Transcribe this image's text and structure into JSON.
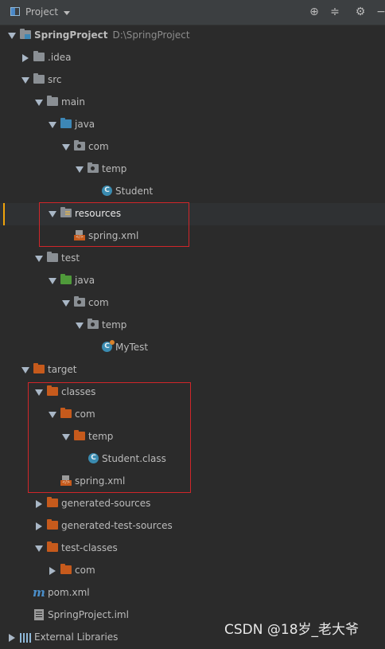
{
  "header": {
    "title": "Project"
  },
  "tree": {
    "project_name": "SpringProject",
    "project_path": "D:\\SpringProject",
    "idea": ".idea",
    "src": "src",
    "main": "main",
    "main_java": "java",
    "main_com": "com",
    "main_temp": "temp",
    "student": "Student",
    "resources": "resources",
    "spring_xml_res": "spring.xml",
    "test": "test",
    "test_java": "java",
    "test_com": "com",
    "test_temp": "temp",
    "mytest": "MyTest",
    "target": "target",
    "classes": "classes",
    "classes_com": "com",
    "classes_temp": "temp",
    "student_class": "Student.class",
    "spring_xml_target": "spring.xml",
    "generated_sources": "generated-sources",
    "generated_test_sources": "generated-test-sources",
    "test_classes": "test-classes",
    "test_classes_com": "com",
    "pom": "pom.xml",
    "iml": "SpringProject.iml",
    "external_libraries": "External Libraries"
  },
  "watermark": "CSDN @18岁_老大爷",
  "colors": {
    "background": "#2b2b2b",
    "highlight_box": "#d0262a",
    "selection_marker": "#f0a30a"
  }
}
